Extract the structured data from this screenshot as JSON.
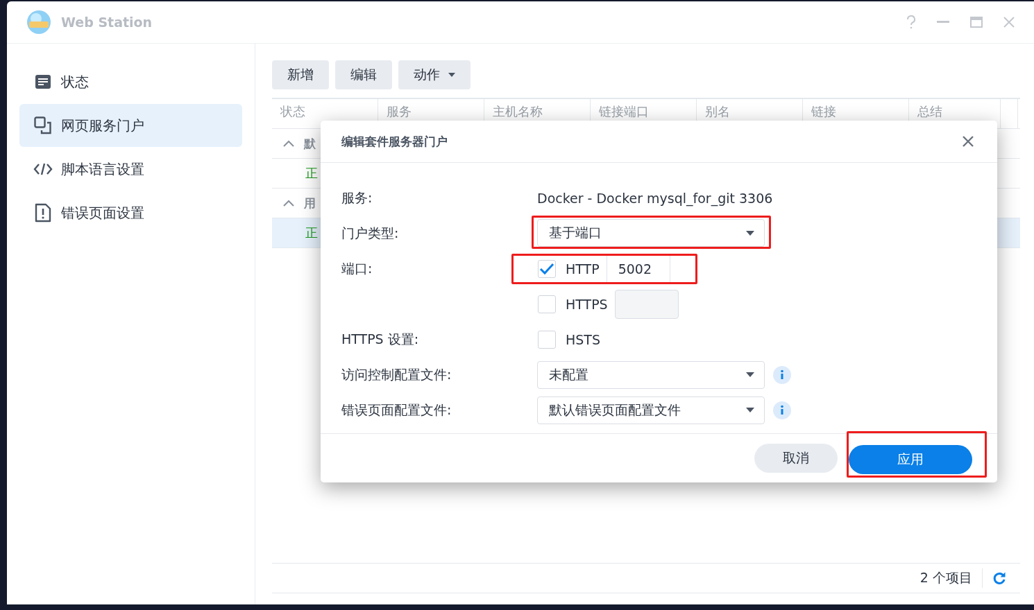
{
  "window": {
    "title": "Web Station"
  },
  "sidebar": {
    "items": [
      {
        "label": "状态",
        "selected": false
      },
      {
        "label": "网页服务门户",
        "selected": true
      },
      {
        "label": "脚本语言设置",
        "selected": false
      },
      {
        "label": "错误页面设置",
        "selected": false
      }
    ]
  },
  "toolbar": [
    {
      "label": "新增",
      "kind": "plain"
    },
    {
      "label": "编辑",
      "kind": "plain"
    },
    {
      "label": "动作",
      "kind": "dropdown"
    }
  ],
  "table": {
    "columns": [
      "状态",
      "服务",
      "主机名称",
      "链接端口",
      "别名",
      "链接",
      "总结"
    ],
    "groups": [
      {
        "label": "默",
        "expanded": true,
        "rows": [
          {
            "status": "正",
            "selected": false
          }
        ]
      },
      {
        "label": "用",
        "expanded": true,
        "rows": [
          {
            "status": "正",
            "selected": true
          }
        ]
      }
    ]
  },
  "footer": {
    "count": "2 个项目"
  },
  "dialog": {
    "title": "编辑套件服务器门户",
    "fields": [
      {
        "kind": "text",
        "label": "服务:",
        "value": "Docker - Docker mysql_for_git 3306"
      },
      {
        "kind": "select",
        "label": "门户类型:",
        "value": "基于端口",
        "highlighted": true
      },
      {
        "kind": "port",
        "label": "端口:",
        "option": "HTTP",
        "checked": true,
        "value": "5002",
        "highlighted": true
      },
      {
        "kind": "port",
        "option": "HTTPS",
        "checked": false,
        "highlighted": false
      },
      {
        "kind": "checkbox",
        "label": "HTTPS 设置:",
        "option": "HSTS",
        "checked": false
      },
      {
        "kind": "select",
        "label": "访问控制配置文件:",
        "value": "未配置",
        "highlighted": false,
        "info": true
      },
      {
        "kind": "select",
        "label": "错误页面配置文件:",
        "value": "默认错误页面配置文件",
        "highlighted": false,
        "info": true
      }
    ],
    "buttons": [
      {
        "label": "取消",
        "kind": "secondary",
        "highlighted": false
      },
      {
        "label": "应用",
        "kind": "primary",
        "highlighted": true
      }
    ]
  }
}
